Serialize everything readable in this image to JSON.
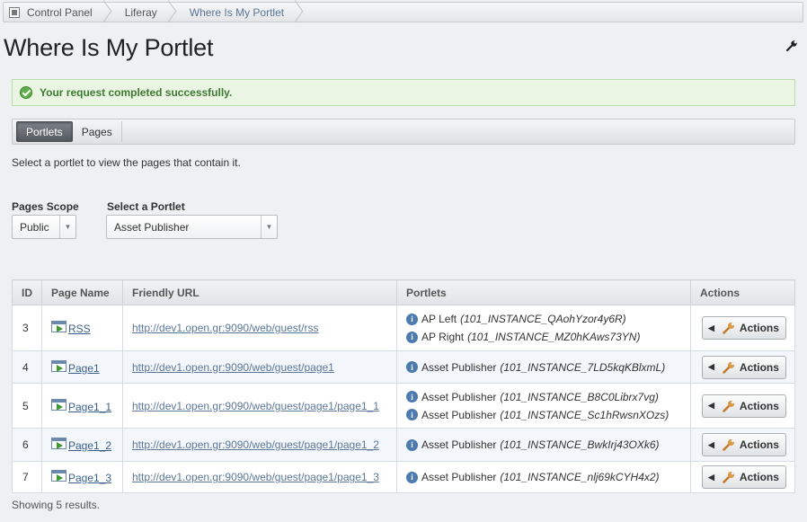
{
  "breadcrumb": [
    "Control Panel",
    "Liferay",
    "Where Is My Portlet"
  ],
  "title": "Where Is My Portlet",
  "success_message": "Your request completed successfully.",
  "tabs": [
    {
      "label": "Portlets",
      "active": true
    },
    {
      "label": "Pages",
      "active": false
    }
  ],
  "intro": "Select a portlet to view the pages that contain it.",
  "form": {
    "scope_label": "Pages Scope",
    "scope_value": "Public",
    "portlet_label": "Select a Portlet",
    "portlet_value": "Asset Publisher"
  },
  "table": {
    "headers": [
      "ID",
      "Page Name",
      "Friendly URL",
      "Portlets",
      "Actions"
    ],
    "action_label": "Actions",
    "rows": [
      {
        "id": "3",
        "name": "RSS",
        "url": "http://dev1.open.gr:9090/web/guest/rss",
        "portlets": [
          {
            "name": "AP Left",
            "instance": "(101_INSTANCE_QAohYzor4y6R)"
          },
          {
            "name": "AP Right",
            "instance": "(101_INSTANCE_MZ0hKAws73YN)"
          }
        ]
      },
      {
        "id": "4",
        "name": "Page1",
        "url": "http://dev1.open.gr:9090/web/guest/page1",
        "portlets": [
          {
            "name": "Asset Publisher",
            "instance": "(101_INSTANCE_7LD5kqKBlxmL)"
          }
        ]
      },
      {
        "id": "5",
        "name": "Page1_1",
        "url": "http://dev1.open.gr:9090/web/guest/page1/page1_1",
        "portlets": [
          {
            "name": "Asset Publisher",
            "instance": "(101_INSTANCE_B8C0Librx7vg)"
          },
          {
            "name": "Asset Publisher",
            "instance": "(101_INSTANCE_Sc1hRwsnXOzs)"
          }
        ]
      },
      {
        "id": "6",
        "name": "Page1_2",
        "url": "http://dev1.open.gr:9090/web/guest/page1/page1_2",
        "portlets": [
          {
            "name": "Asset Publisher",
            "instance": "(101_INSTANCE_BwkIrj43OXk6)"
          }
        ]
      },
      {
        "id": "7",
        "name": "Page1_3",
        "url": "http://dev1.open.gr:9090/web/guest/page1/page1_3",
        "portlets": [
          {
            "name": "Asset Publisher",
            "instance": "(101_INSTANCE_nlj69kCYH4x2)"
          }
        ]
      }
    ]
  },
  "summary": "Showing 5 results.",
  "icons": {
    "success": "check-circle-icon",
    "info": "info-icon",
    "page": "page-icon",
    "wrench": "wrench-icon",
    "control_panel": "control-panel-icon"
  }
}
